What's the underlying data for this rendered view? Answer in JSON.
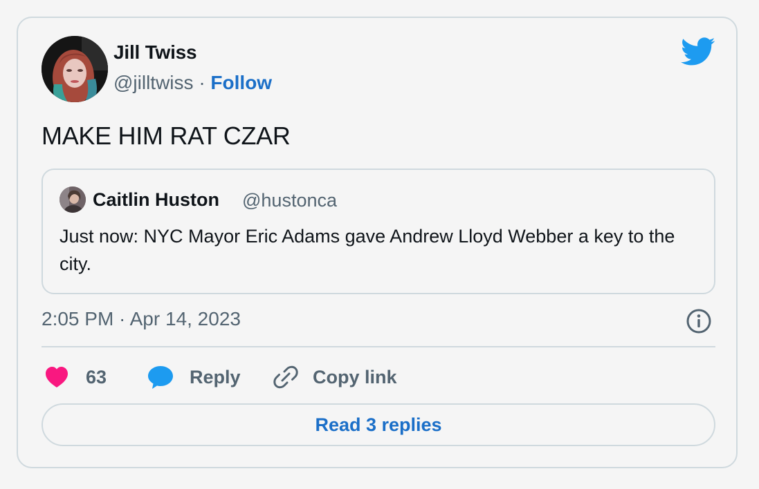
{
  "colors": {
    "brand_blue": "#1d9bf0",
    "link_blue": "#1b6fc8",
    "like_pink": "#f91880",
    "secondary_text": "#536471",
    "border": "#cfd9de"
  },
  "author": {
    "name": "Jill Twiss",
    "handle": "@jilltwiss",
    "separator": "·",
    "follow_label": "Follow",
    "avatar": "profile-photo"
  },
  "brand_icon": "twitter-bird-icon",
  "tweet": {
    "text": "MAKE HIM RAT CZAR",
    "timestamp": "2:05 PM · Apr 14, 2023"
  },
  "quoted_tweet": {
    "name": "Caitlin Huston",
    "handle": "@hustonca",
    "text": "Just now: NYC Mayor Eric Adams gave Andrew Lloyd Webber a key to the city.",
    "avatar": "profile-photo"
  },
  "actions": {
    "like": {
      "icon": "heart-icon",
      "count": "63"
    },
    "reply": {
      "icon": "speech-bubble-icon",
      "label": "Reply"
    },
    "copy_link": {
      "icon": "link-icon",
      "label": "Copy link"
    }
  },
  "info_icon": "info-icon",
  "read_replies": {
    "label": "Read 3 replies"
  }
}
